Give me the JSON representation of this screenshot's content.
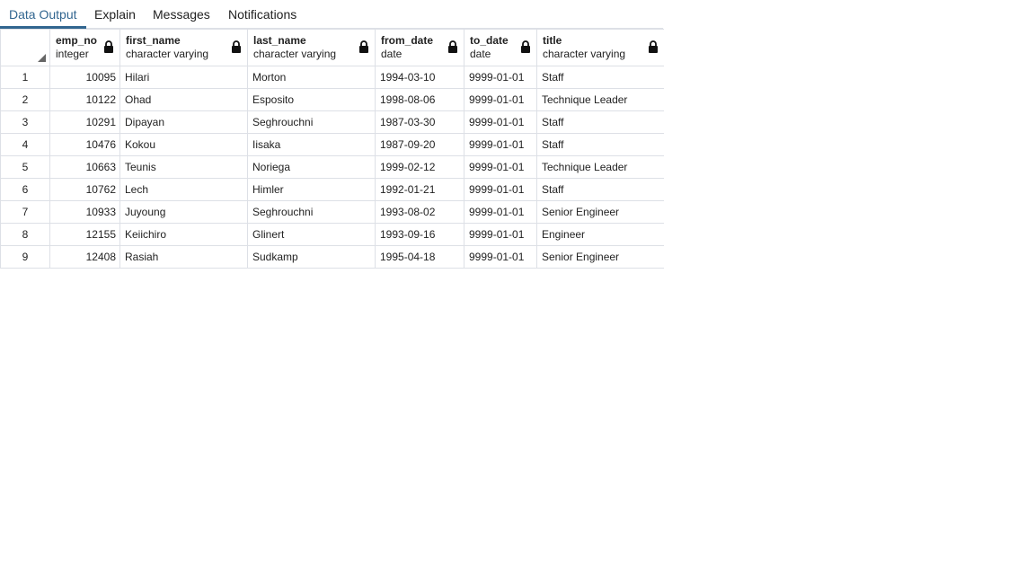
{
  "tabs": [
    {
      "label": "Data Output",
      "active": true
    },
    {
      "label": "Explain",
      "active": false
    },
    {
      "label": "Messages",
      "active": false
    },
    {
      "label": "Notifications",
      "active": false
    }
  ],
  "columns": [
    {
      "name": "emp_no",
      "type": "integer",
      "icon": "lock-icon"
    },
    {
      "name": "first_name",
      "type": "character varying",
      "icon": "lock-icon"
    },
    {
      "name": "last_name",
      "type": "character varying",
      "icon": "lock-icon"
    },
    {
      "name": "from_date",
      "type": "date",
      "icon": "lock-icon"
    },
    {
      "name": "to_date",
      "type": "date",
      "icon": "lock-icon"
    },
    {
      "name": "title",
      "type": "character varying",
      "icon": "lock-icon"
    }
  ],
  "rows": [
    {
      "n": "1",
      "emp_no": "10095",
      "first_name": "Hilari",
      "last_name": "Morton",
      "from_date": "1994-03-10",
      "to_date": "9999-01-01",
      "title": "Staff"
    },
    {
      "n": "2",
      "emp_no": "10122",
      "first_name": "Ohad",
      "last_name": "Esposito",
      "from_date": "1998-08-06",
      "to_date": "9999-01-01",
      "title": "Technique Leader"
    },
    {
      "n": "3",
      "emp_no": "10291",
      "first_name": "Dipayan",
      "last_name": "Seghrouchni",
      "from_date": "1987-03-30",
      "to_date": "9999-01-01",
      "title": "Staff"
    },
    {
      "n": "4",
      "emp_no": "10476",
      "first_name": "Kokou",
      "last_name": "Iisaka",
      "from_date": "1987-09-20",
      "to_date": "9999-01-01",
      "title": "Staff"
    },
    {
      "n": "5",
      "emp_no": "10663",
      "first_name": "Teunis",
      "last_name": "Noriega",
      "from_date": "1999-02-12",
      "to_date": "9999-01-01",
      "title": "Technique Leader"
    },
    {
      "n": "6",
      "emp_no": "10762",
      "first_name": "Lech",
      "last_name": "Himler",
      "from_date": "1992-01-21",
      "to_date": "9999-01-01",
      "title": "Staff"
    },
    {
      "n": "7",
      "emp_no": "10933",
      "first_name": "Juyoung",
      "last_name": "Seghrouchni",
      "from_date": "1993-08-02",
      "to_date": "9999-01-01",
      "title": "Senior Engineer"
    },
    {
      "n": "8",
      "emp_no": "12155",
      "first_name": "Keiichiro",
      "last_name": "Glinert",
      "from_date": "1993-09-16",
      "to_date": "9999-01-01",
      "title": "Engineer"
    },
    {
      "n": "9",
      "emp_no": "12408",
      "first_name": "Rasiah",
      "last_name": "Sudkamp",
      "from_date": "1995-04-18",
      "to_date": "9999-01-01",
      "title": "Senior Engineer"
    }
  ]
}
